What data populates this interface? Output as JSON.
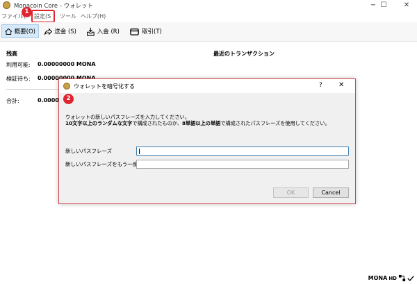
{
  "window": {
    "title": "Monacoin Core - ウォレット",
    "min": "−",
    "max": "☐",
    "close": "✕"
  },
  "menu": {
    "file": "ファイル(",
    "settings": "設定(S",
    "tools": "ツール",
    "help": "ヘルプ(H)"
  },
  "toolbar": {
    "overview": "概要(O)",
    "send": "送金 (S)",
    "receive": "入金 (R)",
    "transactions": "取引(T)"
  },
  "balances": {
    "heading": "残高",
    "available_label": "利用可能:",
    "available_value": "0.00000000 MONA",
    "pending_label": "検証待ち:",
    "pending_value": "0.00000000 MONA",
    "total_label": "合計:",
    "total_value": "0.0000"
  },
  "recent_tx": {
    "heading": "最近のトランザクション"
  },
  "annotations": {
    "step1": "1",
    "step2": "2"
  },
  "dialog": {
    "title": "ウォレットを暗号化する",
    "help": "?",
    "close": "✕",
    "instruction_line1": "ウォレットの新しいパスフレーズを入力してください。",
    "instruction_line2_part1": "10文字以上のランダムな文字",
    "instruction_line2_part2": "で構成されたものか、",
    "instruction_line2_part3": "8単語以上の単語",
    "instruction_line2_part4": "で構成されたパスフレーズを使用してください。",
    "new_passphrase_label": "新しいパスフレーズ",
    "new_passphrase_value": "",
    "repeat_passphrase_label": "新しいパスフレーズをもう一度",
    "repeat_passphrase_value": "",
    "ok_label": "OK",
    "cancel_label": "Cancel"
  },
  "status": {
    "unit": "MONA",
    "hd": "HD"
  },
  "colors": {
    "annotation_red": "#e0242f",
    "toolbar_active": "#d6e9f8",
    "dialog_border": "#d9434a"
  }
}
